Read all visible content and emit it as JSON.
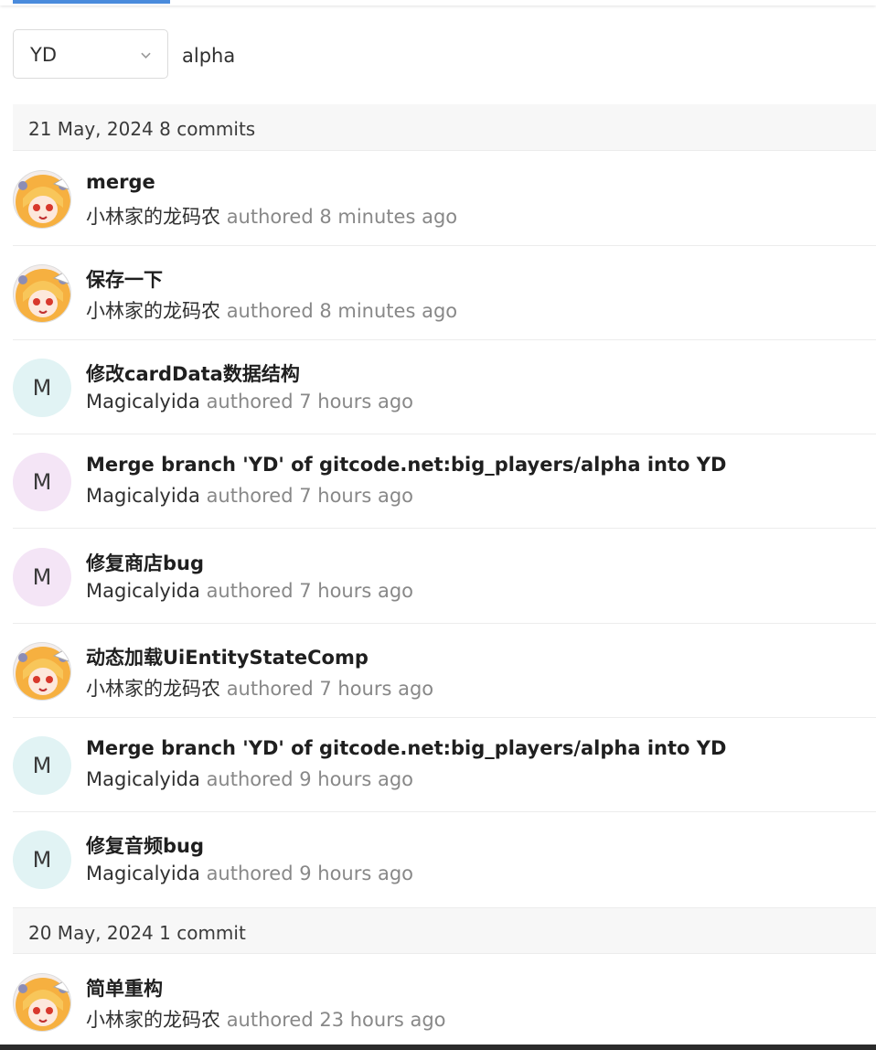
{
  "toolbar": {
    "branch": "YD",
    "path": "alpha"
  },
  "groups": [
    {
      "date": "21 May, 2024 8 commits",
      "commits": [
        {
          "title": "merge",
          "author": "小林家的龙码农",
          "authored": "authored 8 minutes ago",
          "avatar": "anime-avatar"
        },
        {
          "title": "保存一下",
          "author": "小林家的龙码农",
          "authored": "authored 8 minutes ago",
          "avatar": "anime-avatar"
        },
        {
          "title": "修改cardData数据结构",
          "author": "Magicalyida",
          "authored": "authored 7 hours ago",
          "avatar": "M"
        },
        {
          "title": "Merge branch 'YD' of gitcode.net:big_players/alpha into YD",
          "author": "Magicalyida",
          "authored": "authored 7 hours ago",
          "avatar": "M"
        },
        {
          "title": "修复商店bug",
          "author": "Magicalyida",
          "authored": "authored 7 hours ago",
          "avatar": "M"
        },
        {
          "title": "动态加载UiEntityStateComp",
          "author": "小林家的龙码农",
          "authored": "authored 7 hours ago",
          "avatar": "anime-avatar"
        },
        {
          "title": "Merge branch 'YD' of gitcode.net:big_players/alpha into YD",
          "author": "Magicalyida",
          "authored": "authored 9 hours ago",
          "avatar": "M"
        },
        {
          "title": "修复音频bug",
          "author": "Magicalyida",
          "authored": "authored 9 hours ago",
          "avatar": "M"
        }
      ]
    },
    {
      "date": "20 May, 2024 1 commit",
      "commits": [
        {
          "title": "简单重构",
          "author": "小林家的龙码农",
          "authored": "authored 23 hours ago",
          "avatar": "anime-avatar"
        }
      ]
    }
  ],
  "colors": {
    "tab_indicator": "#4a8bdc",
    "avatar_cyan": "#e1f3f4",
    "avatar_purple": "#f4e5f6"
  }
}
